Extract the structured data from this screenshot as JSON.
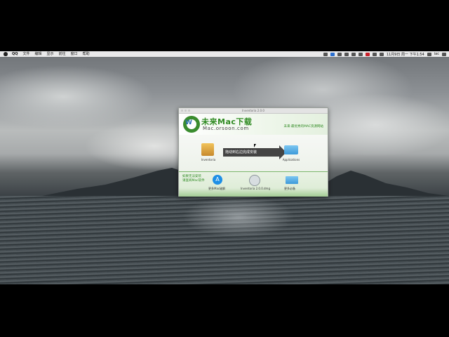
{
  "menubar": {
    "app": "QQ",
    "items": [
      "文件",
      "编辑",
      "显示",
      "前往",
      "窗口",
      "帮助"
    ],
    "clock": "11月9日 周一 下午1:54",
    "user": "iac"
  },
  "window": {
    "title": "Inventoria 2.0.0",
    "brand_name": "未来Mac下载",
    "brand_url": "Mac.orsoon.com",
    "tagline": "未来·最优秀的MAC资源网站",
    "source_item": "Inventoria",
    "drag_instruction": "拖动到右边完成安装",
    "target_item": "Applications",
    "hint_line1": "如果无法安装",
    "hint_line2": "请查阅Mac软件",
    "bottom_items": {
      "appstore": "更多Mac破解",
      "disk": "Inventoria 2.0.0.dmg",
      "desktop": "更多必备"
    }
  },
  "colors": {
    "brand_green": "#2f8a22",
    "accent_blue": "#2b6fb0",
    "arrow": "#444444"
  }
}
